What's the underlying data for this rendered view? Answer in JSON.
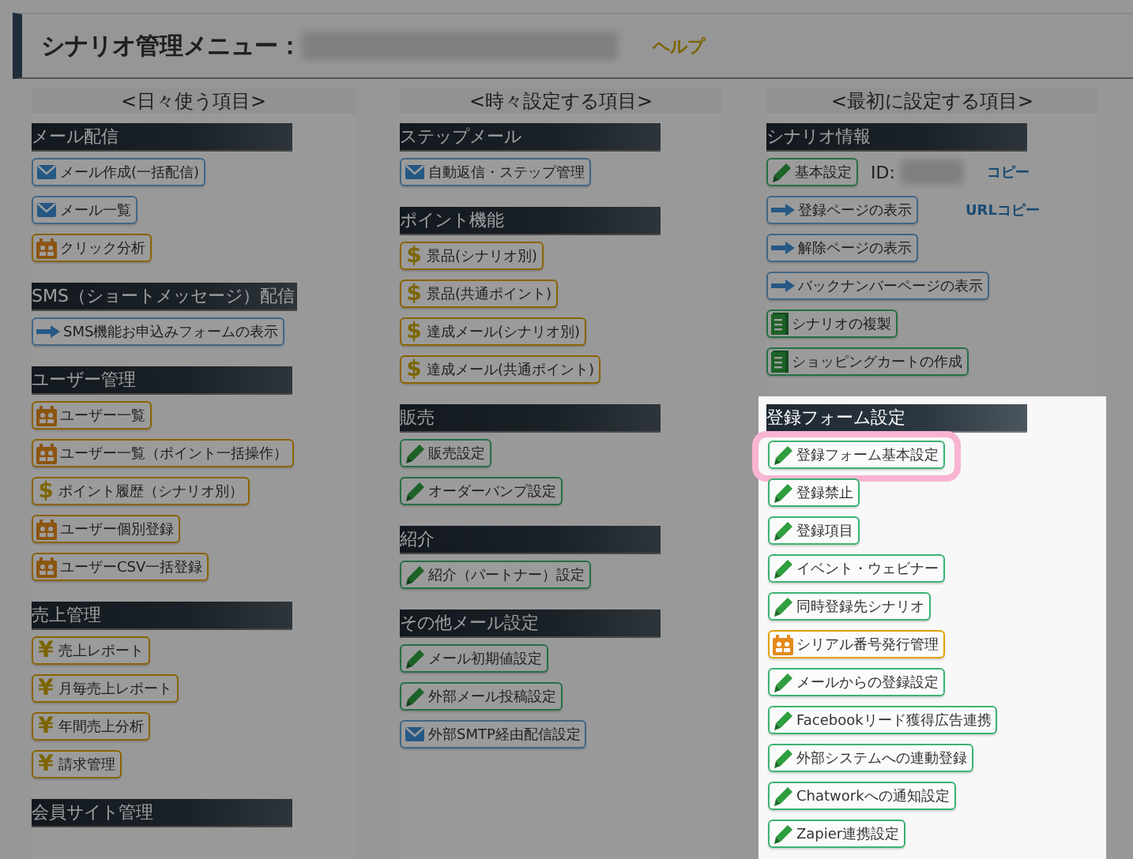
{
  "header": {
    "title": "シナリオ管理メニュー：",
    "help": "ヘルプ"
  },
  "columns": [
    {
      "heading": "<日々使う項目>",
      "sections": [
        {
          "title": "メール配信",
          "spotlight": false,
          "items": [
            {
              "label": "メール作成(一括配信)",
              "kind": "mail"
            },
            {
              "label": "メール一覧",
              "kind": "mail"
            },
            {
              "label": "クリック分析",
              "kind": "user"
            }
          ]
        },
        {
          "title": "SMS（ショートメッセージ）配信",
          "spotlight": false,
          "items": [
            {
              "label": "SMS機能お申込みフォームの表示",
              "kind": "arrow"
            }
          ]
        },
        {
          "title": "ユーザー管理",
          "spotlight": false,
          "items": [
            {
              "label": "ユーザー一覧",
              "kind": "user"
            },
            {
              "label": "ユーザー一覧（ポイント一括操作）",
              "kind": "user"
            },
            {
              "label": "ポイント履歴（シナリオ別）",
              "kind": "currency",
              "symbol": "$"
            },
            {
              "label": "ユーザー個別登録",
              "kind": "user"
            },
            {
              "label": "ユーザーCSV一括登録",
              "kind": "user"
            }
          ]
        },
        {
          "title": "売上管理",
          "spotlight": false,
          "items": [
            {
              "label": "売上レポート",
              "kind": "currency",
              "symbol": "¥"
            },
            {
              "label": "月毎売上レポート",
              "kind": "currency",
              "symbol": "¥"
            },
            {
              "label": "年間売上分析",
              "kind": "currency",
              "symbol": "¥"
            },
            {
              "label": "請求管理",
              "kind": "currency",
              "symbol": "¥"
            }
          ]
        },
        {
          "title": "会員サイト管理",
          "spotlight": false
        }
      ]
    },
    {
      "heading": "<時々設定する項目>",
      "sections": [
        {
          "title": "ステップメール",
          "spotlight": false,
          "items": [
            {
              "label": "自動返信・ステップ管理",
              "kind": "mail"
            }
          ]
        },
        {
          "title": "ポイント機能",
          "spotlight": false,
          "items": [
            {
              "label": "景品(シナリオ別)",
              "kind": "currency",
              "symbol": "$"
            },
            {
              "label": "景品(共通ポイント)",
              "kind": "currency",
              "symbol": "$"
            },
            {
              "label": "達成メール(シナリオ別)",
              "kind": "currency",
              "symbol": "$"
            },
            {
              "label": "達成メール(共通ポイント)",
              "kind": "currency",
              "symbol": "$"
            }
          ]
        },
        {
          "title": "販売",
          "spotlight": false,
          "items": [
            {
              "label": "販売設定",
              "kind": "pencil"
            },
            {
              "label": "オーダーバンプ設定",
              "kind": "pencil"
            }
          ]
        },
        {
          "title": "紹介",
          "spotlight": false,
          "items": [
            {
              "label": "紹介（パートナー）設定",
              "kind": "pencil"
            }
          ]
        },
        {
          "title": "その他メール設定",
          "spotlight": false,
          "items": [
            {
              "label": "メール初期値設定",
              "kind": "pencil"
            },
            {
              "label": "外部メール投稿設定",
              "kind": "pencil"
            },
            {
              "label": "外部SMTP経由配信設定",
              "kind": "mail"
            }
          ]
        }
      ]
    },
    {
      "heading": "<最初に設定する項目>",
      "sections": [
        {
          "title": "シナリオ情報",
          "spotlight": false,
          "items": [
            {
              "label": "基本設定",
              "kind": "pencil",
              "id_label": "ID:",
              "link": "コピー"
            },
            {
              "label": "登録ページの表示",
              "kind": "arrow",
              "link": "URLコピー"
            },
            {
              "label": "解除ページの表示",
              "kind": "arrow"
            },
            {
              "label": "バックナンバーページの表示",
              "kind": "arrow"
            },
            {
              "label": "シナリオの複製",
              "kind": "book"
            },
            {
              "label": "ショッピングカートの作成",
              "kind": "book"
            }
          ]
        },
        {
          "title": "登録フォーム設定",
          "spotlight": true,
          "items": [
            {
              "label": "登録フォーム基本設定",
              "kind": "pencil",
              "highlighted": true
            },
            {
              "label": "登録禁止",
              "kind": "pencil",
              "highlighted": false
            },
            {
              "label": "登録項目",
              "kind": "pencil",
              "highlighted": false
            },
            {
              "label": "イベント・ウェビナー",
              "kind": "pencil",
              "highlighted": false
            },
            {
              "label": "同時登録先シナリオ",
              "kind": "pencil",
              "highlighted": false
            },
            {
              "label": "シリアル番号発行管理",
              "kind": "user",
              "highlighted": false
            },
            {
              "label": "メールからの登録設定",
              "kind": "pencil",
              "highlighted": false
            },
            {
              "label": "Facebookリード獲得広告連携",
              "kind": "pencil",
              "highlighted": false
            },
            {
              "label": "外部システムへの連動登録",
              "kind": "pencil",
              "highlighted": false
            },
            {
              "label": "Chatworkへの通知設定",
              "kind": "pencil",
              "highlighted": false
            },
            {
              "label": "Zapier連携設定",
              "kind": "pencil",
              "highlighted": false
            }
          ]
        }
      ]
    }
  ]
}
